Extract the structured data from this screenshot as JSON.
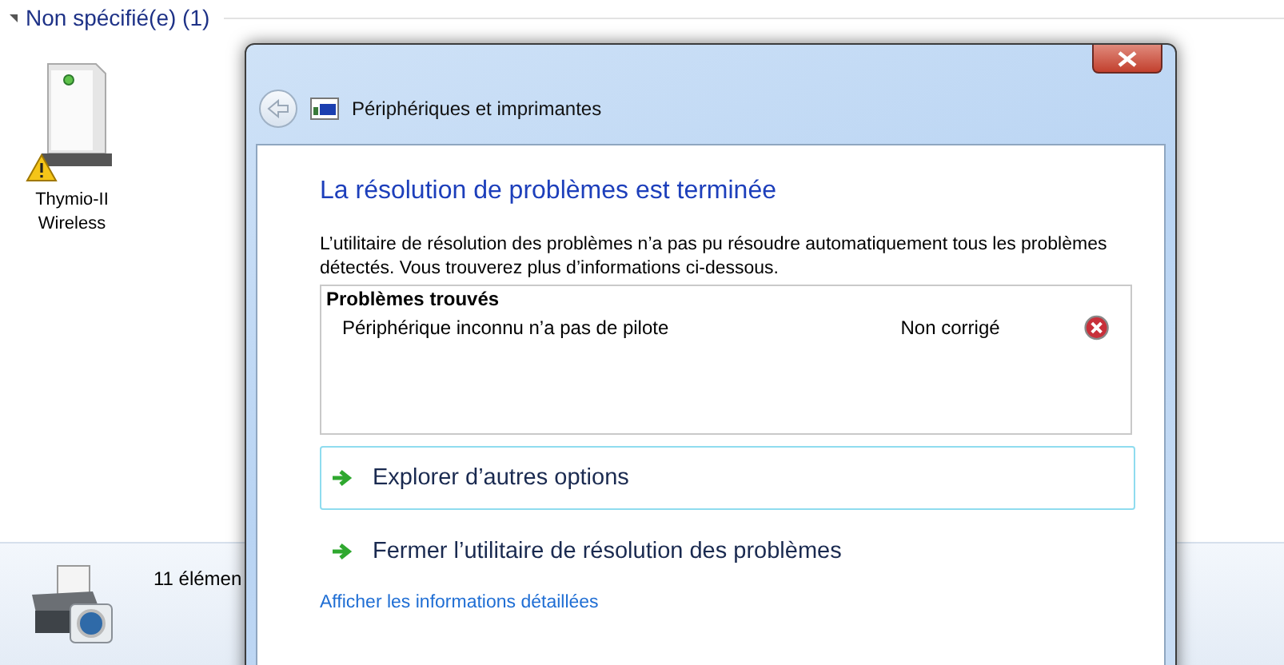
{
  "explorer": {
    "group": {
      "label": "Non spécifié(e) (1)",
      "expanded": true
    },
    "devices": [
      {
        "name": "Thymio-II Wireless",
        "warning": true
      }
    ],
    "status_bar": {
      "text": "11 élémen"
    }
  },
  "dialog": {
    "title": "Périphériques et imprimantes",
    "heading": "La résolution de problèmes est terminée",
    "description": "L’utilitaire de résolution des problèmes n’a pas pu résoudre automatiquement tous les problèmes détectés. Vous trouverez plus d’informations ci-dessous.",
    "problems": {
      "title": "Problèmes trouvés",
      "items": [
        {
          "name": "Périphérique inconnu n’a pas de pilote",
          "status": "Non corrigé",
          "fixed": false
        }
      ]
    },
    "options": [
      {
        "label": "Explorer d’autres options",
        "highlighted": true
      },
      {
        "label": "Fermer l’utilitaire de résolution des problèmes",
        "highlighted": false
      }
    ],
    "link": "Afficher les informations détaillées"
  }
}
